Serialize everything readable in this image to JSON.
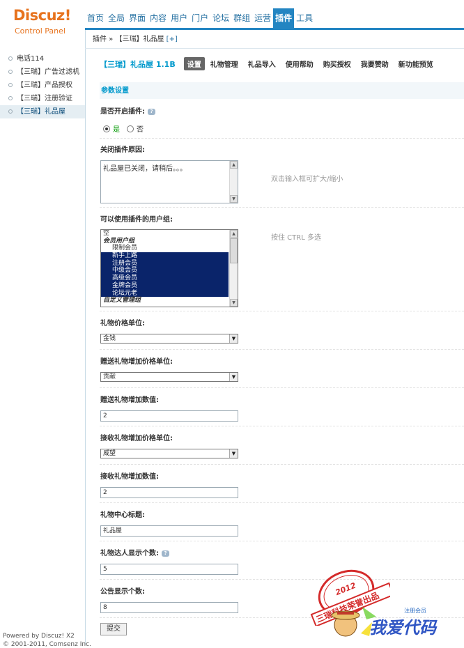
{
  "logo": {
    "name": "Discuz!",
    "sub": "Control Panel"
  },
  "topnav": [
    "首页",
    "全局",
    "界面",
    "内容",
    "用户",
    "门户",
    "论坛",
    "群组",
    "运营",
    "插件",
    "工具"
  ],
  "topnav_active": 9,
  "breadcrumb": {
    "text": "插件 »  【三瑞】礼品屋",
    "plus": "[+]"
  },
  "left_nav": [
    "电话114",
    "【三瑞】广告过滤机",
    "【三瑞】产品授权",
    "【三瑞】注册验证",
    "【三瑞】礼品屋"
  ],
  "left_active": 4,
  "powered": "Powered by Discuz! X2",
  "powered2": "© 2001-2011, Comsenz Inc.",
  "plugin_title": "【三瑞】礼品屋  1.1B",
  "sub_tabs": [
    "设置",
    "礼物管理",
    "礼品导入",
    "使用帮助",
    "购买授权",
    "我要赞助",
    "新功能预览"
  ],
  "section_title": "参数设置",
  "fields": {
    "enable": {
      "label": "是否开启插件:",
      "yes": "是",
      "no": "否"
    },
    "close_reason": {
      "label": "关闭插件原因:",
      "value": "礼品屋已关闭，请稍后。。。",
      "hint": "双击输入框可扩大/缩小"
    },
    "usergroups": {
      "label": "可以使用插件的用户组:",
      "hint": "按住  CTRL 多选",
      "options": [
        {
          "text": "空",
          "type": "plain",
          "selected": false
        },
        {
          "text": "会员用户组",
          "type": "group",
          "selected": false
        },
        {
          "text": "限制会员",
          "type": "indent",
          "selected": false
        },
        {
          "text": "新手上路",
          "type": "indent",
          "selected": true
        },
        {
          "text": "注册会员",
          "type": "indent",
          "selected": true
        },
        {
          "text": "中级会员",
          "type": "indent",
          "selected": true
        },
        {
          "text": "高级会员",
          "type": "indent",
          "selected": true
        },
        {
          "text": "金牌会员",
          "type": "indent",
          "selected": true
        },
        {
          "text": "论坛元老",
          "type": "indent",
          "selected": true
        },
        {
          "text": "自定义管理组",
          "type": "group",
          "selected": false
        }
      ]
    },
    "price_unit": {
      "label": "礼物价格单位:",
      "value": "金钱"
    },
    "gift_add_unit": {
      "label": "赠送礼物增加价格单位:",
      "value": "贡献"
    },
    "gift_add_value": {
      "label": "赠送礼物增加数值:",
      "value": "2"
    },
    "recv_add_unit": {
      "label": "接收礼物增加价格单位:",
      "value": "威望"
    },
    "recv_add_value": {
      "label": "接收礼物增加数值:",
      "value": "2"
    },
    "center_title": {
      "label": "礼物中心标题:",
      "value": "礼品屋"
    },
    "top_count": {
      "label": "礼物达人显示个数:",
      "value": "5"
    },
    "notice_count": {
      "label": "公告显示个数:",
      "value": "8"
    }
  },
  "submit": "提交",
  "stamp": {
    "year": "2012",
    "text": "三瑞科技荣誉出品"
  },
  "watermark": {
    "text": "我爱代码",
    "small": "注册会员"
  },
  "colors": {
    "accent": "#2385c2",
    "logo": "#e7731e",
    "selected": "#0a246a",
    "link": "#236fa1"
  }
}
